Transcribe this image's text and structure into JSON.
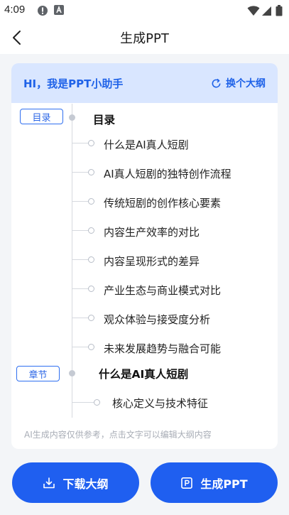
{
  "status": {
    "time": "4:09"
  },
  "header": {
    "title": "生成PPT"
  },
  "card": {
    "greeting": "HI，我是PPT小助手",
    "change_outline": "换个大纲"
  },
  "outline": {
    "toc_tag": "目录",
    "toc_title": "目录",
    "toc_items": [
      "什么是AI真人短剧",
      "AI真人短剧的独特创作流程",
      "传统短剧的创作核心要素",
      "内容生产效率的对比",
      "内容呈现形式的差异",
      "产业生态与商业模式对比",
      "观众体验与接受度分析",
      "未来发展趋势与融合可能"
    ],
    "chapter_tag": "章节",
    "chapter_title": "什么是AI真人短剧",
    "chapter_items": [
      "核心定义与技术特征"
    ]
  },
  "footnote": "AI生成内容仅供参考，点击文字可以编辑大纲内容",
  "actions": {
    "download": "下载大纲",
    "generate": "生成PPT"
  },
  "colors": {
    "accent": "#1f5ff0",
    "head_bg": "#d9e6ff"
  },
  "icons": [
    "back-arrow-icon",
    "refresh-icon",
    "download-icon",
    "ppt-icon",
    "wifi-icon",
    "signal-icon",
    "battery-icon"
  ]
}
